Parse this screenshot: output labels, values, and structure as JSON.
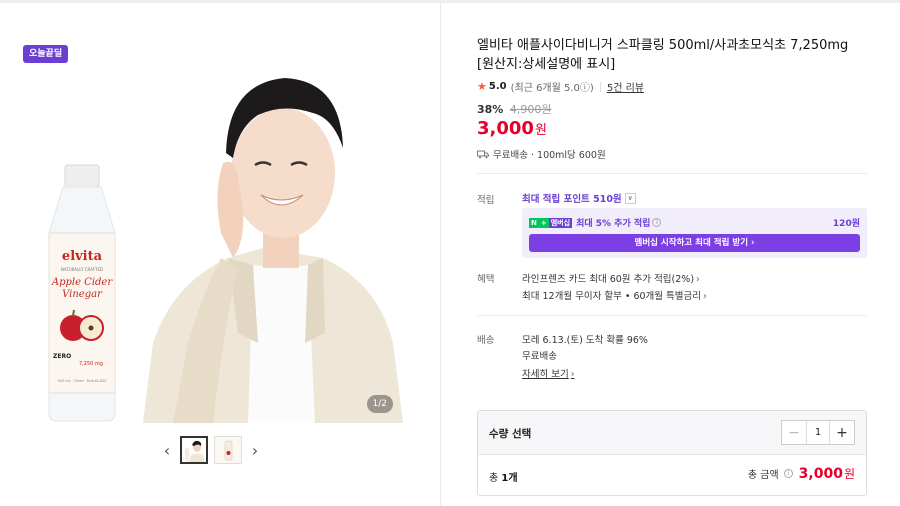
{
  "gallery": {
    "badge": "오늘끝딜",
    "counter": "1/2",
    "prev_arrow": "‹",
    "next_arrow": "›",
    "bottle_brand": "elvita",
    "bottle_subtitle": "NATURALLY CRAFTED",
    "bottle_name_1": "Apple Cider",
    "bottle_name_2": "Vinegar",
    "bottle_zero": "ZERO",
    "bottle_mg": "7,250 mg",
    "bottle_footer": "500 mL · Dried · NutriD-DAY"
  },
  "product": {
    "title": "엘비타 애플사이다비니거 스파클링 500ml/사과초모식초 7,250mg [원산지:상세설명에 표시]",
    "rating": "5.0",
    "rating_recent": "(최근 6개월 5.0ⓘ)",
    "review_link": "5건 리뷰",
    "discount": "38%",
    "original_price": "4,900원",
    "price": "3,000",
    "price_unit": "원",
    "shipping": "무료배송 · 100ml당 600원"
  },
  "points": {
    "label": "적립",
    "head": "최대 적립 포인트 510원",
    "npay_badge_1": "N",
    "npay_badge_2": "+",
    "npay_badge_3": "멤버십",
    "membership_text": "최대 5% 추가 적립",
    "membership_points": "120원",
    "membership_button": "멤버십 시작하고 최대 적립 받기 ›"
  },
  "benefits": {
    "label": "혜택",
    "line1": "라인프렌즈 카드 최대 60원 추가 적립(2%)",
    "line2": "최대 12개월 무이자 할부 • 60개월 특별금리"
  },
  "delivery": {
    "label": "배송",
    "line1": "모레 6.13.(토) 도착 확률 96%",
    "line2": "무료배송",
    "detail_link": "자세히 보기"
  },
  "quantity": {
    "label": "수량 선택",
    "value": "1",
    "minus": "−",
    "plus": "+",
    "total_count_prefix": "총 ",
    "total_count": "1개",
    "total_label": "총 금액",
    "total_price": "3,000",
    "total_unit": "원"
  },
  "colors": {
    "accent_purple": "#6b3fd4",
    "price_red": "#e5002b",
    "star_orange": "#ff5a3d"
  }
}
